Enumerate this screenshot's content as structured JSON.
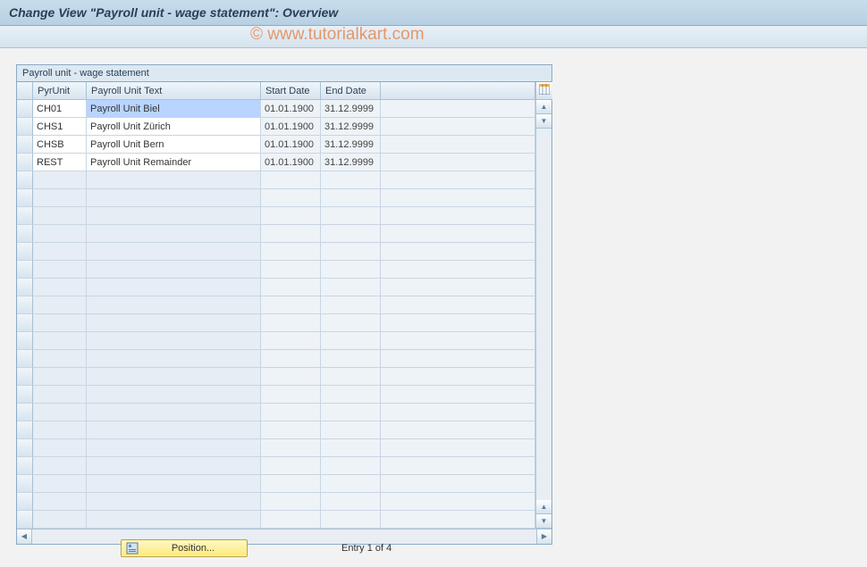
{
  "title": "Change View \"Payroll unit - wage statement\": Overview",
  "watermark": "© www.tutorialkart.com",
  "table": {
    "caption": "Payroll unit - wage statement",
    "columns": {
      "pyrunit": "PyrUnit",
      "text": "Payroll Unit Text",
      "start": "Start Date",
      "end": "End Date"
    },
    "rows": [
      {
        "pyrunit": "CH01",
        "text": "Payroll Unit Biel",
        "start": "01.01.1900",
        "end": "31.12.9999",
        "selected": true
      },
      {
        "pyrunit": "CHS1",
        "text": "Payroll Unit Zürich",
        "start": "01.01.1900",
        "end": "31.12.9999",
        "selected": false
      },
      {
        "pyrunit": "CHSB",
        "text": "Payroll Unit Bern",
        "start": "01.01.1900",
        "end": "31.12.9999",
        "selected": false
      },
      {
        "pyrunit": "REST",
        "text": "Payroll Unit Remainder",
        "start": "01.01.1900",
        "end": "31.12.9999",
        "selected": false
      }
    ],
    "empty_row_count": 20
  },
  "footer": {
    "position_label": "Position...",
    "entry_status": "Entry 1 of 4"
  },
  "icons": {
    "table_settings": "table-settings-icon",
    "scroll_up": "▲",
    "scroll_down": "▼",
    "scroll_left": "◀",
    "scroll_right": "▶"
  }
}
